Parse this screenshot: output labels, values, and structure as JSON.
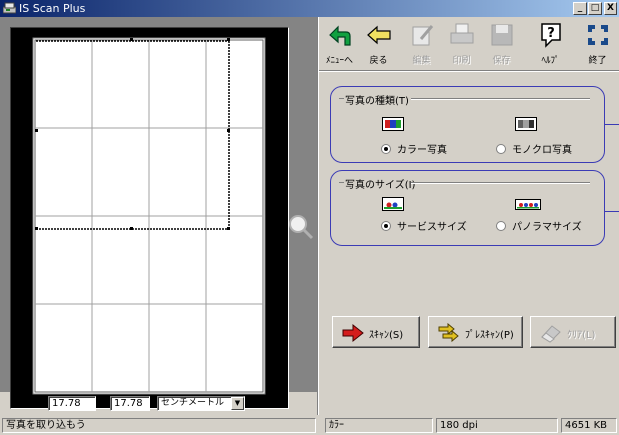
{
  "window": {
    "title": "IS Scan Plus",
    "minimize_label": "_",
    "restore_label": "□",
    "close_label": "X"
  },
  "toolbar": {
    "items": [
      {
        "label": "ﾒﾆｭｰへ",
        "icon": "back-to-menu-icon",
        "enabled": true
      },
      {
        "label": "戻る",
        "icon": "back-arrow-icon",
        "enabled": true
      },
      {
        "label": "編集",
        "icon": "edit-icon",
        "enabled": false
      },
      {
        "label": "印刷",
        "icon": "print-icon",
        "enabled": false
      },
      {
        "label": "保存",
        "icon": "save-icon",
        "enabled": false
      },
      {
        "label": "ﾍﾙﾌﾟ",
        "icon": "help-icon",
        "enabled": true
      },
      {
        "label": "終了",
        "icon": "exit-icon",
        "enabled": true
      }
    ]
  },
  "photo_type": {
    "title": "写真の種類(T)",
    "options": [
      {
        "label": "カラー写真",
        "selected": true,
        "icon": "color-photo-icon"
      },
      {
        "label": "モノクロ写真",
        "selected": false,
        "icon": "mono-photo-icon"
      }
    ]
  },
  "photo_size": {
    "title": "写真のサイズ(I)",
    "options": [
      {
        "label": "サービスサイズ",
        "selected": true,
        "icon": "service-size-icon"
      },
      {
        "label": "パノラマサイズ",
        "selected": false,
        "icon": "panorama-size-icon"
      }
    ]
  },
  "actions": {
    "scan": "ｽｷｬﾝ(S)",
    "prescan": "ﾌﾟﾚｽｷｬﾝ(P)",
    "clear": "ｸﾘｱ(L)"
  },
  "dimensions": {
    "width": "17.78",
    "times": "x",
    "height": "17.78",
    "unit": "センチメートル"
  },
  "status": {
    "message": "写真を取り込もう",
    "mode": "ｶﾗｰ",
    "resolution": "180 dpi",
    "size": "4651 KB"
  },
  "colors": {
    "group_border": "#3b3bb5",
    "title_bar": "#0a246a",
    "scan_arrow": "#d41c1c",
    "prescan_arrow": "#e0c020"
  }
}
